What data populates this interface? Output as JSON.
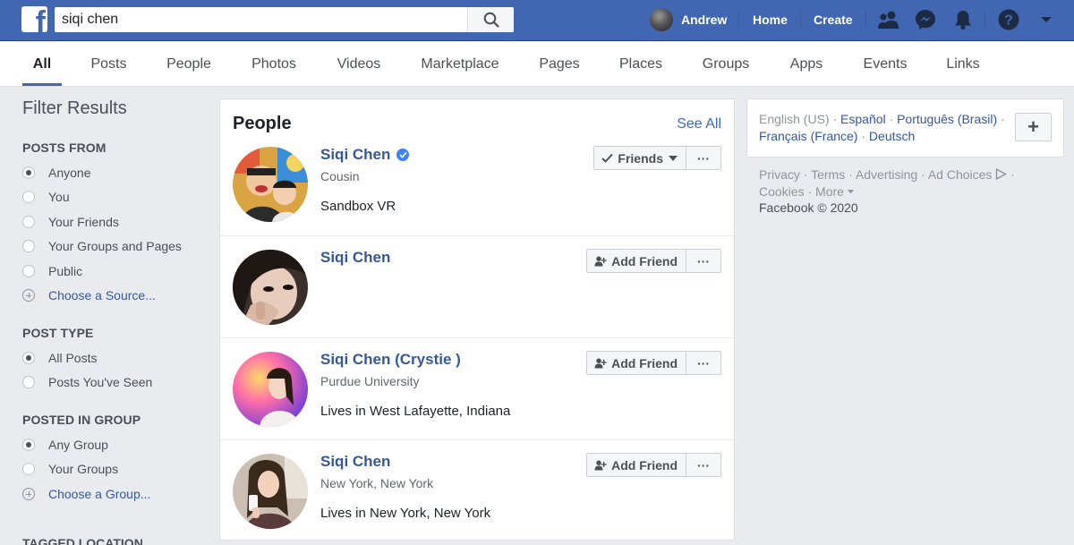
{
  "topbar": {
    "search_value": "siqi chen",
    "user_name": "Andrew",
    "home_label": "Home",
    "create_label": "Create"
  },
  "tabs": [
    "All",
    "Posts",
    "People",
    "Photos",
    "Videos",
    "Marketplace",
    "Pages",
    "Places",
    "Groups",
    "Apps",
    "Events",
    "Links"
  ],
  "active_tab": "All",
  "filters": {
    "title": "Filter Results",
    "posts_from": {
      "heading": "POSTS FROM",
      "options": [
        "Anyone",
        "You",
        "Your Friends",
        "Your Groups and Pages",
        "Public"
      ],
      "selected": "Anyone",
      "link": "Choose a Source..."
    },
    "post_type": {
      "heading": "POST TYPE",
      "options": [
        "All Posts",
        "Posts You've Seen"
      ],
      "selected": "All Posts"
    },
    "posted_in_group": {
      "heading": "POSTED IN GROUP",
      "options": [
        "Any Group",
        "Your Groups"
      ],
      "selected": "Any Group",
      "link": "Choose a Group..."
    },
    "tagged_location": {
      "heading": "TAGGED LOCATION"
    }
  },
  "people_card": {
    "title": "People",
    "see_all": "See All",
    "results": [
      {
        "name": "Siqi Chen",
        "verified": true,
        "subtitle": "Cousin",
        "detail": "Sandbox VR",
        "action": "Friends"
      },
      {
        "name": "Siqi Chen",
        "verified": false,
        "subtitle": "",
        "detail": "",
        "action": "Add Friend"
      },
      {
        "name": "Siqi Chen (Crystie )",
        "verified": false,
        "subtitle": "Purdue University",
        "detail": "Lives in West Lafayette, Indiana",
        "action": "Add Friend"
      },
      {
        "name": "Siqi Chen",
        "verified": false,
        "subtitle": "New York, New York",
        "detail": "Lives in New York, New York",
        "action": "Add Friend"
      }
    ],
    "more_label": "···"
  },
  "languages": {
    "current": "English (US)",
    "others": [
      "Español",
      "Português (Brasil)",
      "Français (France)",
      "Deutsch"
    ],
    "add_label": "+"
  },
  "footer": {
    "links": [
      "Privacy",
      "Terms",
      "Advertising",
      "Ad Choices",
      "Cookies",
      "More"
    ],
    "copyright": "Facebook © 2020"
  },
  "colors": {
    "brand_blue": "#4267b2",
    "link_blue": "#365899",
    "verified_blue": "#4080ff",
    "page_bg": "#e9ebee"
  }
}
